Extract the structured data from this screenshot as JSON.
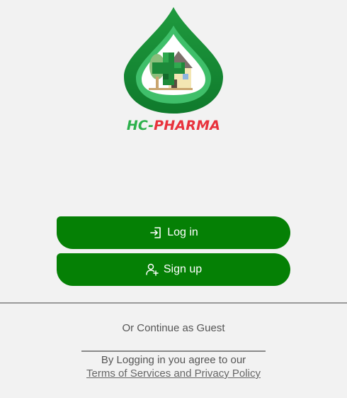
{
  "app": {
    "brand_prefix": "HC-",
    "brand_suffix": "PHARMA",
    "colors": {
      "primary_button": "#058005",
      "brand_green": "#2bb04b",
      "brand_red": "#e8323c",
      "background": "#f2f2f2"
    }
  },
  "actions": {
    "login_label": "Log in",
    "login_icon": "login-icon",
    "signup_label": "Sign up",
    "signup_icon": "add-user-icon"
  },
  "footer": {
    "guest_label": "Or Continue as Guest",
    "agree_text": "By Logging in you agree to our",
    "terms_link": "Terms of Services and Privacy Policy"
  }
}
